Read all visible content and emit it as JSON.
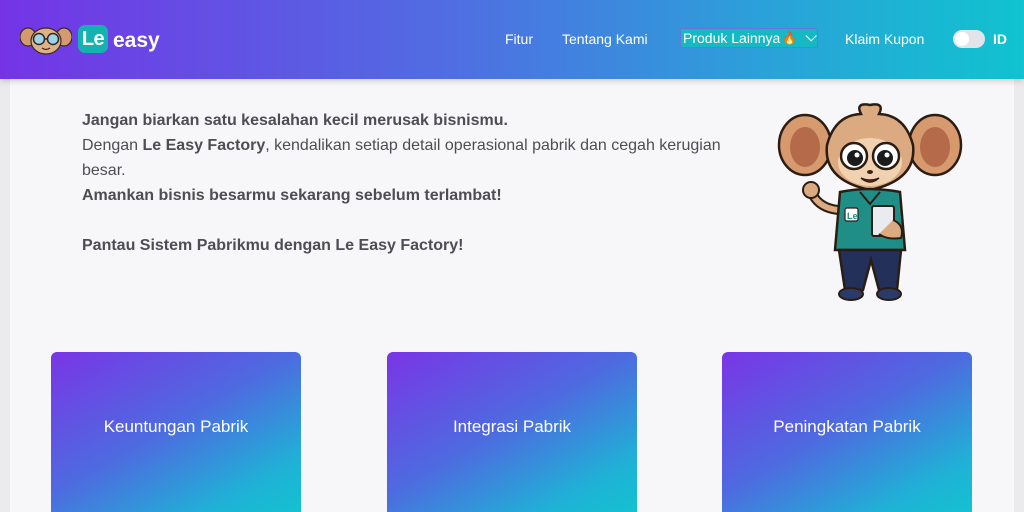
{
  "header": {
    "brand_le": "Le",
    "brand_easy": "easy",
    "nav": {
      "fitur": "Fitur",
      "tentang": "Tentang Kami",
      "produk": "Produk Lainnya",
      "klaim": "Klaim Kupon"
    },
    "language": "ID",
    "toggle_on": false
  },
  "intro": {
    "line1": "Jangan biarkan satu kesalahan kecil merusak bisnismu.",
    "line2_prefix": "Dengan ",
    "line2_brand": "Le Easy Factory",
    "line2_suffix": ", kendalikan setiap detail operasional pabrik dan cegah kerugian besar.",
    "line3": "Amankan bisnis besarmu sekarang sebelum terlambat!",
    "line4": "Pantau Sistem Pabrikmu dengan Le Easy Factory!"
  },
  "cards": [
    {
      "label": "Keuntungan Pabrik"
    },
    {
      "label": "Integrasi Pabrik"
    },
    {
      "label": "Peningkatan Pabrik"
    }
  ],
  "colors": {
    "header_start": "#7434e6",
    "header_end": "#10c3cf",
    "brand_teal": "#15b3b0",
    "text": "#4e4e52"
  }
}
